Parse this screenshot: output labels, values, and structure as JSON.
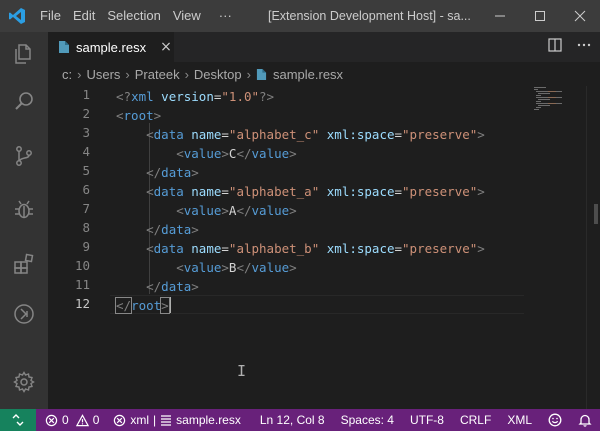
{
  "colors": {
    "titlebar": "#3c3c3c",
    "activitybar": "#333333",
    "editor_bg": "#1e1e1e",
    "statusbar": "#68217a",
    "remote_indicator": "#16825d",
    "tag": "#569cd6",
    "attribute": "#9cdcfe",
    "string": "#ce9178",
    "punctuation": "#808080"
  },
  "titlebar": {
    "logo_icon": "vscode-logo-icon",
    "menu": [
      "File",
      "Edit",
      "Selection",
      "View",
      "···"
    ],
    "title": "[Extension Development Host] - sa..."
  },
  "activity_icons": [
    "explorer-icon",
    "search-icon",
    "source-control-icon",
    "debug-icon",
    "extensions-icon",
    "remote-explorer-icon",
    "settings-gear-icon"
  ],
  "tab": {
    "icon": "file-icon",
    "label": "sample.resx",
    "close": "×"
  },
  "breadcrumb": [
    "c:",
    "Users",
    "Prateek",
    "Desktop",
    "sample.resx"
  ],
  "editor": {
    "line_numbers": [
      "1",
      "2",
      "3",
      "4",
      "5",
      "6",
      "7",
      "8",
      "9",
      "10",
      "11",
      "12"
    ],
    "active_line": 12,
    "lines": [
      [
        {
          "t": "<?",
          "c": "punc"
        },
        {
          "t": "xml",
          "c": "tag"
        },
        {
          "t": " ",
          "c": "text"
        },
        {
          "t": "version",
          "c": "attr"
        },
        {
          "t": "=",
          "c": "text"
        },
        {
          "t": "\"1.0\"",
          "c": "str"
        },
        {
          "t": "?>",
          "c": "punc"
        }
      ],
      [
        {
          "t": "<",
          "c": "punc"
        },
        {
          "t": "root",
          "c": "tag"
        },
        {
          "t": ">",
          "c": "punc"
        }
      ],
      [
        {
          "t": "    ",
          "c": "text"
        },
        {
          "t": "<",
          "c": "punc"
        },
        {
          "t": "data",
          "c": "tag"
        },
        {
          "t": " ",
          "c": "text"
        },
        {
          "t": "name",
          "c": "attr"
        },
        {
          "t": "=",
          "c": "text"
        },
        {
          "t": "\"alphabet_c\"",
          "c": "str"
        },
        {
          "t": " ",
          "c": "text"
        },
        {
          "t": "xml:space",
          "c": "attr"
        },
        {
          "t": "=",
          "c": "text"
        },
        {
          "t": "\"preserve\"",
          "c": "str"
        },
        {
          "t": ">",
          "c": "punc"
        }
      ],
      [
        {
          "t": "        ",
          "c": "text"
        },
        {
          "t": "<",
          "c": "punc"
        },
        {
          "t": "value",
          "c": "tag"
        },
        {
          "t": ">",
          "c": "punc"
        },
        {
          "t": "C",
          "c": "text"
        },
        {
          "t": "</",
          "c": "punc"
        },
        {
          "t": "value",
          "c": "tag"
        },
        {
          "t": ">",
          "c": "punc"
        }
      ],
      [
        {
          "t": "    ",
          "c": "text"
        },
        {
          "t": "</",
          "c": "punc"
        },
        {
          "t": "data",
          "c": "tag"
        },
        {
          "t": ">",
          "c": "punc"
        }
      ],
      [
        {
          "t": "    ",
          "c": "text"
        },
        {
          "t": "<",
          "c": "punc"
        },
        {
          "t": "data",
          "c": "tag"
        },
        {
          "t": " ",
          "c": "text"
        },
        {
          "t": "name",
          "c": "attr"
        },
        {
          "t": "=",
          "c": "text"
        },
        {
          "t": "\"alphabet_a\"",
          "c": "str"
        },
        {
          "t": " ",
          "c": "text"
        },
        {
          "t": "xml:space",
          "c": "attr"
        },
        {
          "t": "=",
          "c": "text"
        },
        {
          "t": "\"preserve\"",
          "c": "str"
        },
        {
          "t": ">",
          "c": "punc"
        }
      ],
      [
        {
          "t": "        ",
          "c": "text"
        },
        {
          "t": "<",
          "c": "punc"
        },
        {
          "t": "value",
          "c": "tag"
        },
        {
          "t": ">",
          "c": "punc"
        },
        {
          "t": "A",
          "c": "text"
        },
        {
          "t": "</",
          "c": "punc"
        },
        {
          "t": "value",
          "c": "tag"
        },
        {
          "t": ">",
          "c": "punc"
        }
      ],
      [
        {
          "t": "    ",
          "c": "text"
        },
        {
          "t": "</",
          "c": "punc"
        },
        {
          "t": "data",
          "c": "tag"
        },
        {
          "t": ">",
          "c": "punc"
        }
      ],
      [
        {
          "t": "    ",
          "c": "text"
        },
        {
          "t": "<",
          "c": "punc"
        },
        {
          "t": "data",
          "c": "tag"
        },
        {
          "t": " ",
          "c": "text"
        },
        {
          "t": "name",
          "c": "attr"
        },
        {
          "t": "=",
          "c": "text"
        },
        {
          "t": "\"alphabet_b\"",
          "c": "str"
        },
        {
          "t": " ",
          "c": "text"
        },
        {
          "t": "xml:space",
          "c": "attr"
        },
        {
          "t": "=",
          "c": "text"
        },
        {
          "t": "\"preserve\"",
          "c": "str"
        },
        {
          "t": ">",
          "c": "punc"
        }
      ],
      [
        {
          "t": "        ",
          "c": "text"
        },
        {
          "t": "<",
          "c": "punc"
        },
        {
          "t": "value",
          "c": "tag"
        },
        {
          "t": ">",
          "c": "punc"
        },
        {
          "t": "B",
          "c": "text"
        },
        {
          "t": "</",
          "c": "punc"
        },
        {
          "t": "value",
          "c": "tag"
        },
        {
          "t": ">",
          "c": "punc"
        }
      ],
      [
        {
          "t": "    ",
          "c": "text"
        },
        {
          "t": "</",
          "c": "punc"
        },
        {
          "t": "data",
          "c": "tag"
        },
        {
          "t": ">",
          "c": "punc"
        }
      ],
      [
        {
          "t": "</",
          "c": "punc"
        },
        {
          "t": "root",
          "c": "tag"
        },
        {
          "t": ">",
          "c": "punc"
        }
      ]
    ]
  },
  "statusbar": {
    "remote_icon": "remote-icon",
    "errors": "0",
    "warnings": "0",
    "language_id": "xml",
    "separator": "|",
    "file": "sample.resx",
    "position": "Ln 12, Col 8",
    "spaces": "Spaces: 4",
    "encoding": "UTF-8",
    "eol": "CRLF",
    "language": "XML",
    "feedback_icon": "smiley-icon",
    "notifications_icon": "bell-icon"
  }
}
